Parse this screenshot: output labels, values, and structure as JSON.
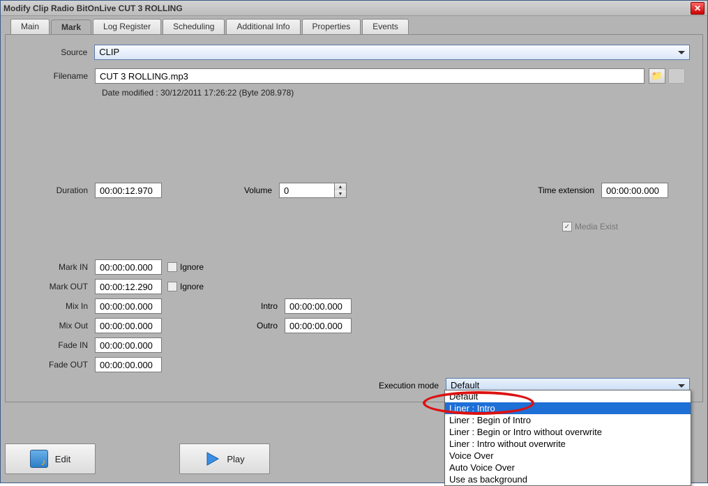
{
  "window": {
    "title": "Modify Clip Radio BitOnLive CUT 3 ROLLING"
  },
  "tabs": [
    "Main",
    "Mark",
    "Log Register",
    "Scheduling",
    "Additional Info",
    "Properties",
    "Events"
  ],
  "active_tab": "Mark",
  "labels": {
    "source": "Source",
    "filename": "Filename",
    "duration": "Duration",
    "volume": "Volume",
    "time_ext": "Time extension",
    "media_exist": "Media Exist",
    "mark_in": "Mark IN",
    "mark_out": "Mark OUT",
    "mix_in": "Mix In",
    "mix_out": "Mix Out",
    "fade_in": "Fade IN",
    "fade_out": "Fade OUT",
    "intro": "Intro",
    "outro": "Outro",
    "ignore": "Ignore",
    "exec_mode": "Execution mode"
  },
  "values": {
    "source": "CLIP",
    "filename": "CUT 3 ROLLING.mp3",
    "meta": "Date modified : 30/12/2011 17:26:22   (Byte 208.978)",
    "duration": "00:00:12.970",
    "volume": "0",
    "time_ext": "00:00:00.000",
    "mark_in": "00:00:00.000",
    "mark_out": "00:00:12.290",
    "mix_in": "00:00:00.000",
    "mix_out": "00:00:00.000",
    "fade_in": "00:00:00.000",
    "fade_out": "00:00:00.000",
    "intro": "00:00:00.000",
    "outro": "00:00:00.000",
    "exec_mode": "Default"
  },
  "exec_options": [
    "Default",
    "Liner : Intro",
    "Liner : Begin of Intro",
    "Liner : Begin or Intro without overwrite",
    "Liner : Intro without overwrite",
    "Voice Over",
    "Auto Voice Over",
    "Use as background"
  ],
  "exec_highlight_index": 1,
  "buttons": {
    "edit": "Edit",
    "play": "Play"
  }
}
